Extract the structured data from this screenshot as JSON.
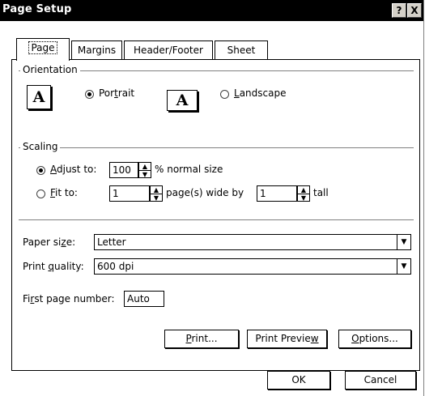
{
  "window": {
    "title": "Page Setup",
    "help_label": "?",
    "close_label": "X"
  },
  "tabs": [
    {
      "label": "Page",
      "active": true
    },
    {
      "label": "Margins"
    },
    {
      "label": "Header/Footer"
    },
    {
      "label": "Sheet"
    }
  ],
  "orientation": {
    "group_label": "Orientation",
    "portrait": {
      "label_pre": "Por",
      "label_u": "t",
      "label_post": "rait",
      "selected": true,
      "icon_glyph": "A"
    },
    "landscape": {
      "label_pre": "",
      "label_u": "L",
      "label_post": "andscape",
      "selected": false,
      "icon_glyph": "A"
    }
  },
  "scaling": {
    "group_label": "Scaling",
    "adjust": {
      "label_pre": "",
      "label_u": "A",
      "label_post": "djust to:",
      "selected": true,
      "value": "100",
      "suffix": "% normal size"
    },
    "fit": {
      "label_pre": "",
      "label_u": "F",
      "label_post": "it to:",
      "selected": false,
      "wide_value": "1",
      "wide_suffix": "page(s) wide by",
      "tall_value": "1",
      "tall_suffix": "tall"
    }
  },
  "paper_size": {
    "label_pre": "Paper si",
    "label_u": "z",
    "label_post": "e:",
    "value": "Letter"
  },
  "print_quality": {
    "label_pre": "Print ",
    "label_u": "q",
    "label_post": "uality:",
    "value": "600 dpi"
  },
  "first_page": {
    "label_pre": "Fi",
    "label_u": "r",
    "label_post": "st page number:",
    "value": "Auto"
  },
  "buttons": {
    "print": {
      "pre": "",
      "u": "P",
      "post": "rint..."
    },
    "preview": {
      "pre": "Print Previe",
      "u": "w",
      "post": ""
    },
    "options": {
      "pre": "",
      "u": "O",
      "post": "ptions..."
    },
    "ok": "OK",
    "cancel": "Cancel"
  },
  "icons": {
    "spin_up": "▲",
    "spin_down": "▼",
    "dropdown": "▼"
  }
}
